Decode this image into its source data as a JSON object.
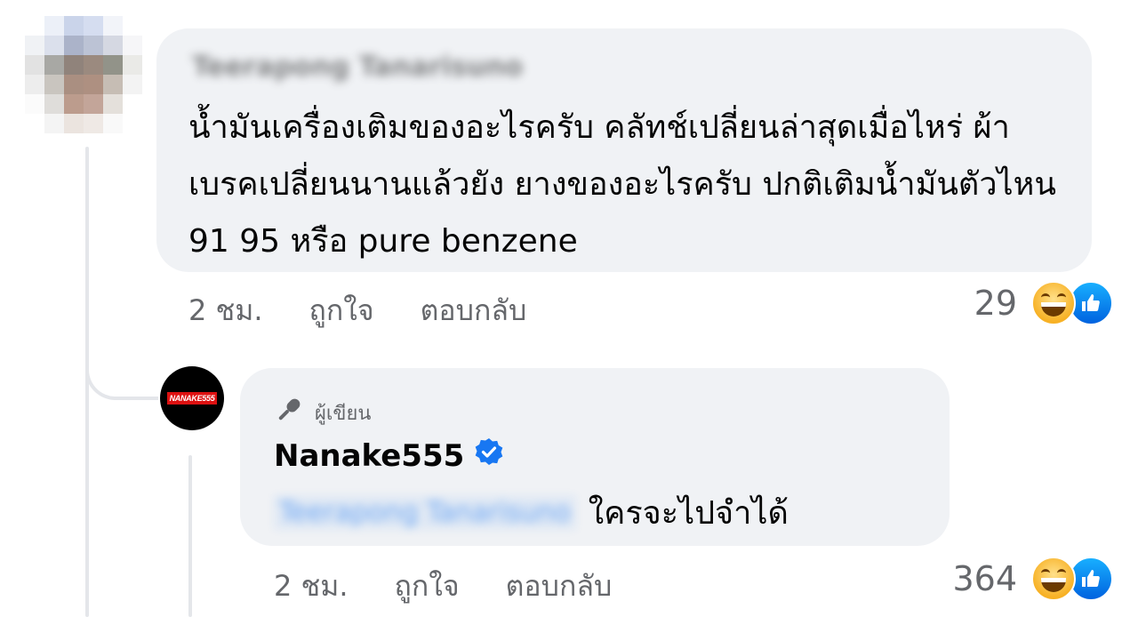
{
  "comment": {
    "author_name": "Teerapong Tanarisuno",
    "text": "น้ำมันเครื่องเติมของอะไรครับ คลัทช์เปลี่ยนล่าสุดเมื่อไหร่ ผ้าเบรคเปลี่ยนนานแล้วยัง ยางของอะไรครับ ปกติเติมน้ำมันตัวไหน 91 95 หรือ pure benzene",
    "time": "2 ชม.",
    "like_label": "ถูกใจ",
    "reply_label": "ตอบกลับ",
    "reaction_count": "29"
  },
  "reply": {
    "author_badge": "ผู้เขียน",
    "author_name": "Nanake555",
    "avatar_logo": "NANAKE555",
    "mention": "Teerapong Tanarisuno",
    "text": "ใครจะไปจำได้",
    "time": "2 ชม.",
    "like_label": "ถูกใจ",
    "reply_label": "ตอบกลับ",
    "reaction_count": "364"
  },
  "colors": {
    "bubble": "#f0f2f5",
    "meta_text": "#65676b",
    "verified": "#1877f2",
    "like_blue": "#0866ff"
  },
  "icons": [
    "microphone-icon",
    "verified-badge-icon",
    "haha-reaction-icon",
    "like-reaction-icon"
  ]
}
